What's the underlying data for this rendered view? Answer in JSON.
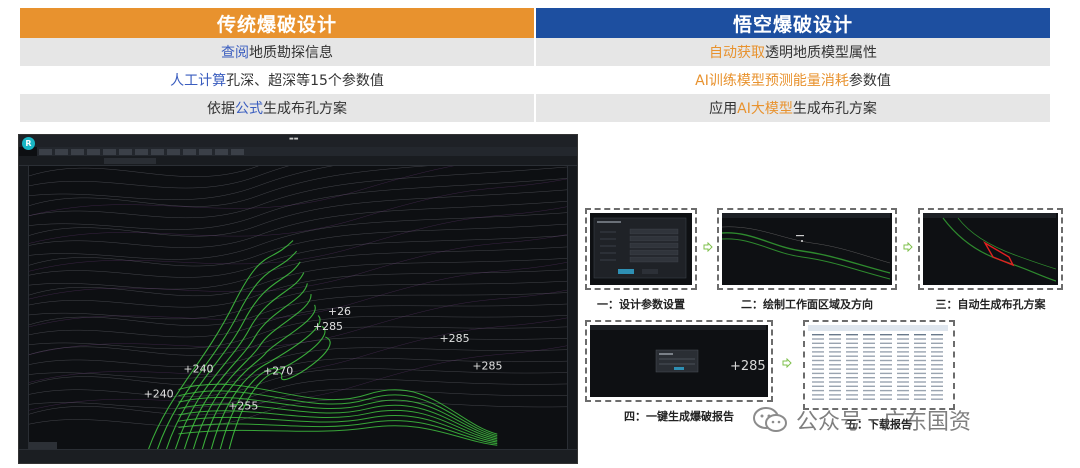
{
  "comparison": {
    "left_header": "传统爆破设计",
    "right_header": "悟空爆破设计",
    "rows": [
      {
        "left": [
          {
            "text": "查阅",
            "style": "blue"
          },
          {
            "text": "地质勘探信息",
            "style": ""
          }
        ],
        "right": [
          {
            "text": "自动获取",
            "style": "orange"
          },
          {
            "text": "透明地质模型属性",
            "style": ""
          }
        ]
      },
      {
        "left": [
          {
            "text": "人工计算",
            "style": "blue"
          },
          {
            "text": "孔深、超深等15个参数值",
            "style": ""
          }
        ],
        "right": [
          {
            "text": "AI训练模型预测能量消耗",
            "style": "orange"
          },
          {
            "text": "参数值",
            "style": ""
          }
        ]
      },
      {
        "left": [
          {
            "text": "依据",
            "style": ""
          },
          {
            "text": "公式",
            "style": "blue"
          },
          {
            "text": "生成布孔方案",
            "style": ""
          }
        ],
        "right": [
          {
            "text": "应用",
            "style": ""
          },
          {
            "text": "AI大模型",
            "style": "orange"
          },
          {
            "text": "生成布孔方案",
            "style": ""
          }
        ]
      }
    ]
  },
  "cad": {
    "logo": "R",
    "labels": [
      {
        "text": "+26"
      },
      {
        "text": "+285"
      },
      {
        "text": "+285"
      },
      {
        "text": "+240"
      },
      {
        "text": "+270"
      },
      {
        "text": "+285"
      },
      {
        "text": "+240"
      },
      {
        "text": "+255"
      }
    ]
  },
  "workflow": {
    "steps": [
      {
        "caption": "一：设计参数设置"
      },
      {
        "caption": "二：绘制工作面区域及方向"
      },
      {
        "caption": "三：自动生成布孔方案"
      },
      {
        "caption": "四：一键生成爆破报告"
      },
      {
        "caption": "五：下载报告"
      }
    ],
    "step4_label": "+285"
  },
  "watermark": {
    "text": "公众号 · 广东国资"
  },
  "colors": {
    "orange": "#e8922e",
    "blue": "#1d4fa0",
    "contour_green": "#3fbf3f"
  }
}
